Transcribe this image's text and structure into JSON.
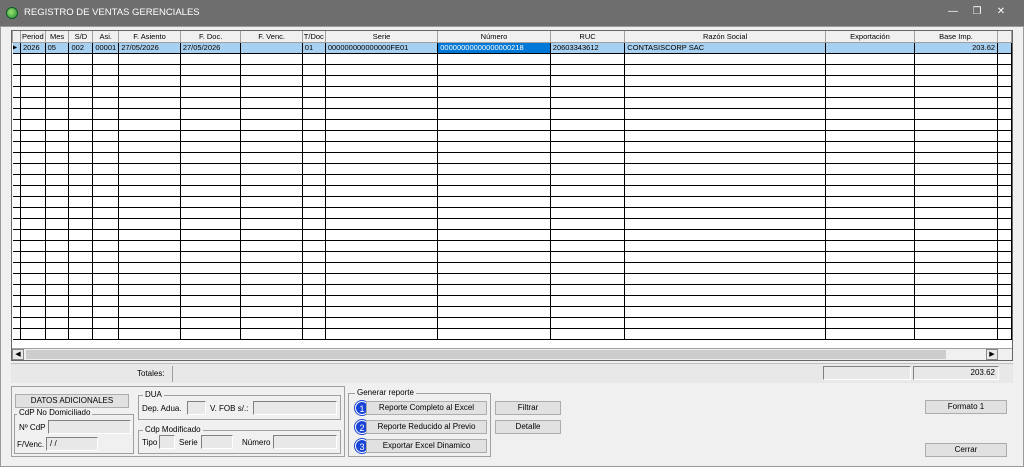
{
  "window": {
    "title": "REGISTRO DE VENTAS GERENCIALES",
    "minimize": "—",
    "restore": "❐",
    "close": "✕"
  },
  "grid": {
    "columns": [
      "Period",
      "Mes",
      "S/D",
      "Asi.",
      "F. Asiento",
      "F. Doc.",
      "F. Venc.",
      "T/Doc",
      "Serie",
      "Número",
      "RUC",
      "Razón Social",
      "Exportación",
      "Base Imp."
    ],
    "rows": [
      [
        "2026",
        "05",
        "002",
        "00001",
        "27/05/2026",
        "27/05/2026",
        "",
        "01",
        "000000000000000FE01",
        "00000000000000000218",
        "20603343612",
        "CONTASISCORP SAC",
        "",
        "203.62"
      ]
    ],
    "row_indicator": "▶"
  },
  "totals": {
    "label": "Totales:",
    "export_total": "",
    "base_total": "203.62"
  },
  "datos_adicionales": {
    "button": "DATOS ADICIONALES",
    "no_domiciliado": {
      "group": "CdP No Domiciliado",
      "ncdp_label": "Nº CdP",
      "ncdp_value": "",
      "fvenc_label": "F/Venc.",
      "fvenc_value": " /  /"
    },
    "dua": {
      "group": "DUA",
      "dep_label": "Dep. Adua.",
      "dep_value": "",
      "fob_label": "V. FOB s/.:",
      "fob_value": ""
    },
    "cdp_modificado": {
      "group": "Cdp Modificado",
      "tipo_label": "Tipo",
      "tipo_value": "",
      "serie_label": "Serie",
      "serie_value": "",
      "numero_label": "Número",
      "numero_value": ""
    }
  },
  "generar_reporte": {
    "group": "Generar reporte",
    "items": [
      {
        "badge": "1",
        "label": "Reporte Completo al Excel"
      },
      {
        "badge": "2",
        "label": "Reporte Reducido al Previo"
      },
      {
        "badge": "3",
        "label": "Exportar Excel Dinamico"
      }
    ]
  },
  "actions": {
    "filtrar": "Filtrar",
    "detalle": "Detalle",
    "formato": "Formato 1",
    "cerrar": "Cerrar"
  },
  "colors": {
    "titlebar": "#6e6e6e",
    "selected_row": "#a8d0f0",
    "current_cell": "#0078d7",
    "badge": "#1a44d6"
  },
  "icons": {
    "app": "app-logo-icon",
    "row_indicator": "row-pointer-icon",
    "scroll_left": "scroll-left-icon",
    "scroll_right": "scroll-right-icon"
  }
}
